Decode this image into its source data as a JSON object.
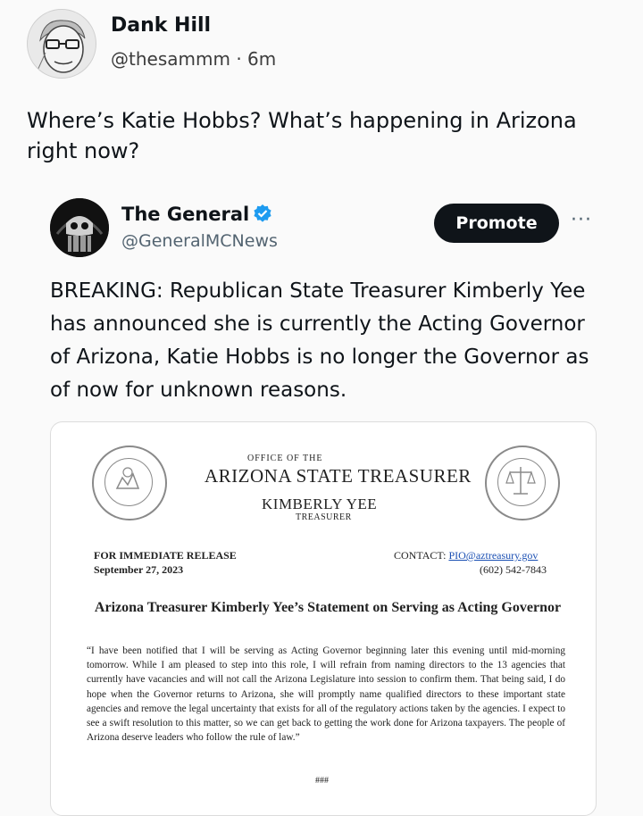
{
  "tweet": {
    "author_name": "Dank Hill",
    "author_handle": "@thesammm",
    "time_ago": "6m",
    "separator": "·",
    "text": "Where’s Katie Hobbs? What’s happening in Arizona\nright now?"
  },
  "quoted_tweet": {
    "author_name": "The General",
    "author_handle": "@GeneralMCNews",
    "promote_label": "Promote",
    "more_label": "···",
    "text": "BREAKING: Republican State Treasurer Kimberly Yee has announced she is currently the Acting Governor of Arizona, Katie Hobbs is no longer the Governor as of now for unknown reasons.",
    "verified_color": "#1d9bf0"
  },
  "document": {
    "office_of_the": "OFFICE OF THE",
    "office_title": "ARIZONA STATE TREASURER",
    "treasurer_name": "KIMBERLY YEE",
    "treasurer_title": "TREASURER",
    "release_label": "FOR IMMEDIATE RELEASE",
    "release_date": "September 27, 2023",
    "contact_label": "CONTACT:",
    "contact_email": "PIO@aztreasury.gov",
    "contact_phone": "(602) 542-7843",
    "headline": "Arizona Treasurer Kimberly Yee’s Statement on Serving as Acting Governor",
    "statement": "“I have been notified that I will be serving as Acting Governor beginning later this evening until mid-morning tomorrow. While I am pleased to step into this role, I will refrain from naming directors to the 13 agencies that currently have vacancies and will not call the Arizona Legislature into session to confirm them. That being said, I do hope when the Governor returns to Arizona, she will promptly name qualified directors to these important state agencies and remove the legal uncertainty that exists for all of the regulatory actions taken by the agencies. I expect to see a swift resolution to this matter, so we can get back to getting the work done for Arizona taxpayers. The people of Arizona deserve leaders who follow the rule of law.”",
    "end_mark": "###"
  }
}
